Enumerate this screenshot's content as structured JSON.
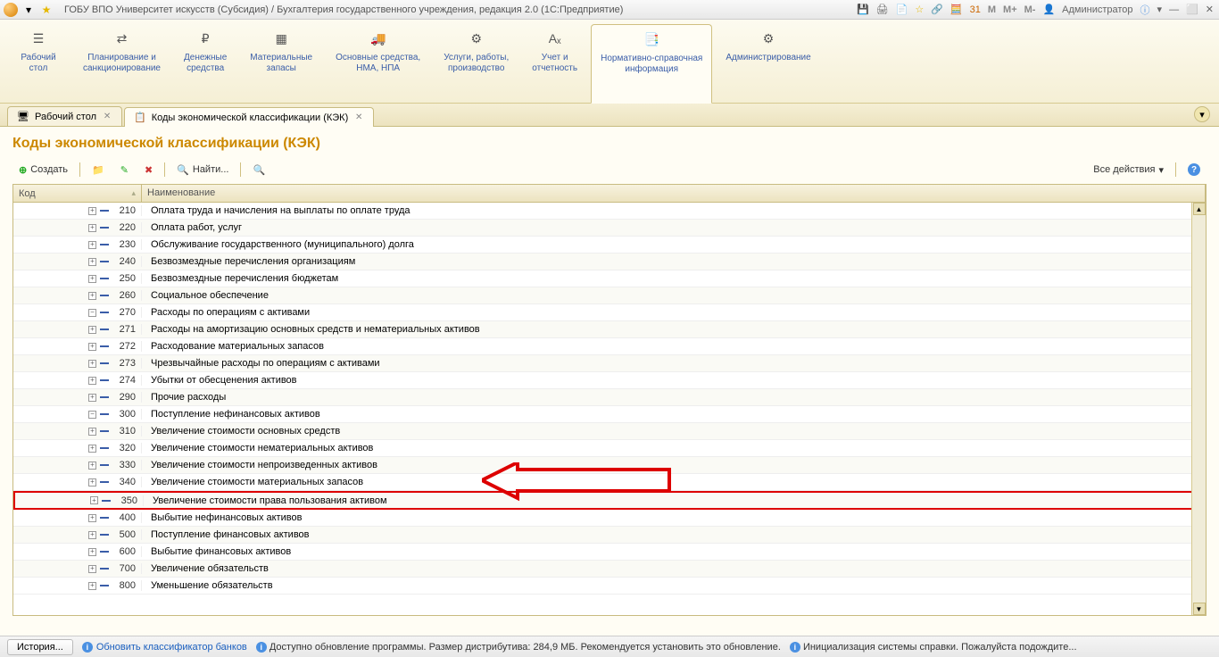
{
  "titlebar": {
    "title": "ГОБУ ВПО Университет искусств (Субсидия) / Бухгалтерия государственного учреждения, редакция 2.0  (1С:Предприятие)",
    "user": "Администратор",
    "m_labels": [
      "M",
      "M+",
      "M-"
    ]
  },
  "sections": [
    {
      "label": "Рабочий\nстол",
      "icon": "menu"
    },
    {
      "label": "Планирование и\nсанкционирование",
      "icon": "plan"
    },
    {
      "label": "Денежные\nсредства",
      "icon": "money"
    },
    {
      "label": "Материальные\nзапасы",
      "icon": "boxes"
    },
    {
      "label": "Основные средства,\nНМА, НПА",
      "icon": "truck"
    },
    {
      "label": "Услуги, работы,\nпроизводство",
      "icon": "sliders"
    },
    {
      "label": "Учет и\nотчетность",
      "icon": "report"
    },
    {
      "label": "Нормативно-справочная\nинформация",
      "icon": "docs",
      "active": true
    },
    {
      "label": "Администрирование",
      "icon": "gear"
    }
  ],
  "tabs": [
    {
      "label": "Рабочий стол",
      "icon": "desktop"
    },
    {
      "label": "Коды экономической классификации (КЭК)",
      "icon": "list",
      "active": true
    }
  ],
  "page": {
    "title": "Коды экономической классификации (КЭК)"
  },
  "toolbar": {
    "create": "Создать",
    "find": "Найти...",
    "all_actions": "Все действия"
  },
  "grid": {
    "headers": {
      "code": "Код",
      "name": "Наименование"
    },
    "rows": [
      {
        "indent": 1,
        "exp": "plus",
        "code": "210",
        "name": "Оплата труда и начисления на выплаты по оплате труда"
      },
      {
        "indent": 1,
        "exp": "plus",
        "code": "220",
        "name": "Оплата работ, услуг"
      },
      {
        "indent": 1,
        "exp": "plus",
        "code": "230",
        "name": "Обслуживание государственного (муниципального) долга"
      },
      {
        "indent": 1,
        "exp": "plus",
        "code": "240",
        "name": "Безвозмездные перечисления организациям"
      },
      {
        "indent": 1,
        "exp": "plus",
        "code": "250",
        "name": "Безвозмездные перечисления бюджетам"
      },
      {
        "indent": 1,
        "exp": "plus",
        "code": "260",
        "name": "Социальное обеспечение"
      },
      {
        "indent": 1,
        "exp": "minus",
        "code": "270",
        "name": "Расходы по операциям с активами"
      },
      {
        "indent": 2,
        "exp": "plus",
        "code": "271",
        "name": "Расходы на амортизацию основных средств и нематериальных активов"
      },
      {
        "indent": 2,
        "exp": "plus",
        "code": "272",
        "name": "Расходование материальных запасов"
      },
      {
        "indent": 2,
        "exp": "plus",
        "code": "273",
        "name": "Чрезвычайные расходы по операциям с активами"
      },
      {
        "indent": 2,
        "exp": "plus",
        "code": "274",
        "name": "Убытки от обесценения активов"
      },
      {
        "indent": 1,
        "exp": "plus",
        "code": "290",
        "name": "Прочие расходы"
      },
      {
        "indent": 0,
        "exp": "minus",
        "code": "300",
        "name": "Поступление нефинансовых активов"
      },
      {
        "indent": 1,
        "exp": "plus",
        "code": "310",
        "name": "Увеличение стоимости основных средств"
      },
      {
        "indent": 1,
        "exp": "plus",
        "code": "320",
        "name": "Увеличение стоимости нематериальных активов"
      },
      {
        "indent": 1,
        "exp": "plus",
        "code": "330",
        "name": "Увеличение стоимости непроизведенных активов"
      },
      {
        "indent": 1,
        "exp": "plus",
        "code": "340",
        "name": "Увеличение стоимости материальных запасов"
      },
      {
        "indent": 1,
        "exp": "plus",
        "code": "350",
        "name": "Увеличение стоимости права пользования активом",
        "highlight": true
      },
      {
        "indent": 0,
        "exp": "plus",
        "code": "400",
        "name": "Выбытие нефинансовых активов"
      },
      {
        "indent": 0,
        "exp": "plus",
        "code": "500",
        "name": "Поступление финансовых активов"
      },
      {
        "indent": 0,
        "exp": "plus",
        "code": "600",
        "name": "Выбытие финансовых активов"
      },
      {
        "indent": 0,
        "exp": "plus",
        "code": "700",
        "name": "Увеличение обязательств"
      },
      {
        "indent": 0,
        "exp": "plus",
        "code": "800",
        "name": "Уменьшение обязательств"
      }
    ]
  },
  "statusbar": {
    "history": "История...",
    "link1": "Обновить классификатор банков",
    "text1": "Доступно обновление программы. Размер дистрибутива: 284,9 МБ. Рекомендуется установить это обновление.",
    "text2": "Инициализация системы справки. Пожалуйста подождите..."
  }
}
